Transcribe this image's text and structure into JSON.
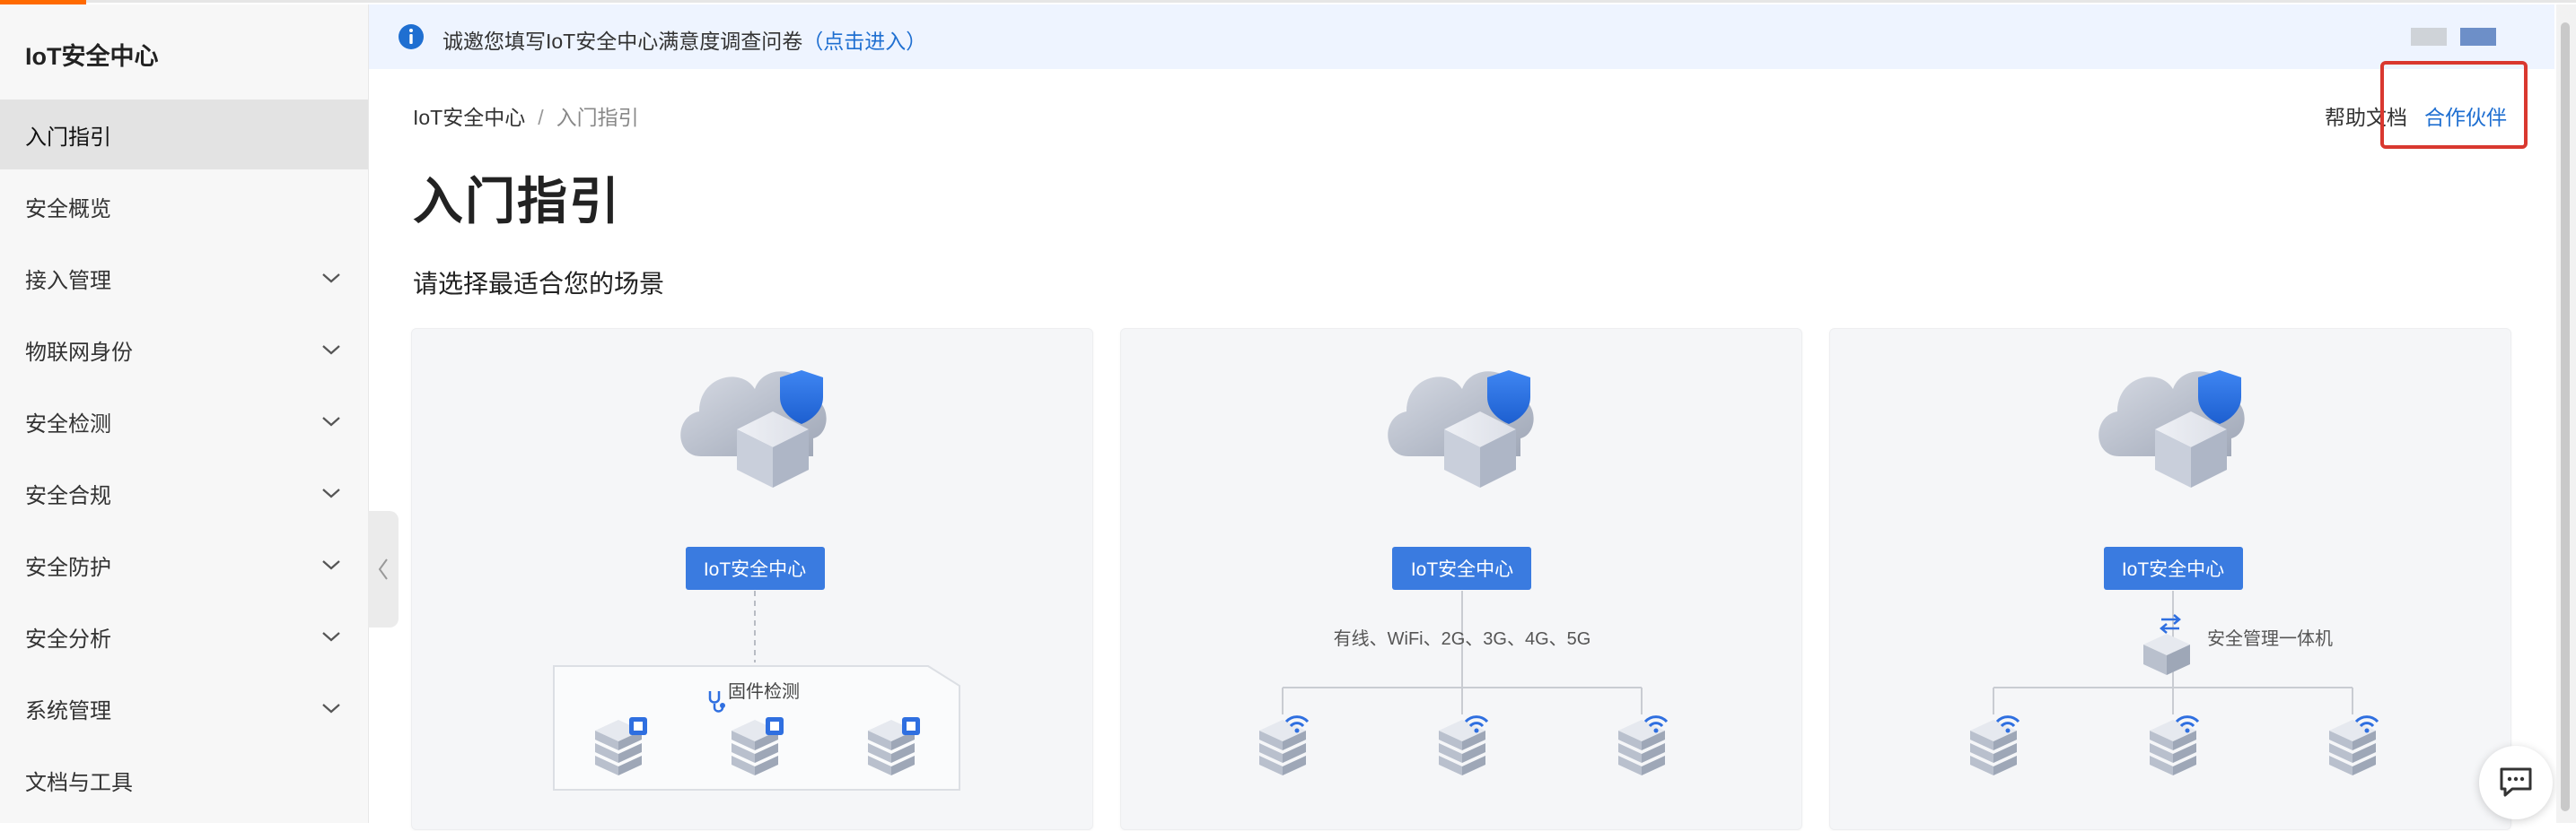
{
  "app": {
    "brand": "IoT安全中心"
  },
  "sidebar": {
    "items": [
      {
        "label": "入门指引",
        "active": true,
        "expandable": false
      },
      {
        "label": "安全概览",
        "active": false,
        "expandable": false
      },
      {
        "label": "接入管理",
        "active": false,
        "expandable": true
      },
      {
        "label": "物联网身份",
        "active": false,
        "expandable": true
      },
      {
        "label": "安全检测",
        "active": false,
        "expandable": true
      },
      {
        "label": "安全合规",
        "active": false,
        "expandable": true
      },
      {
        "label": "安全防护",
        "active": false,
        "expandable": true
      },
      {
        "label": "安全分析",
        "active": false,
        "expandable": true
      },
      {
        "label": "系统管理",
        "active": false,
        "expandable": true
      },
      {
        "label": "文档与工具",
        "active": false,
        "expandable": false
      }
    ]
  },
  "notice": {
    "text": "诚邀您填写IoT安全中心满意度调查问卷",
    "link": "（点击进入）",
    "icon": "info-icon"
  },
  "breadcrumb": {
    "root": "IoT安全中心",
    "separator": "/",
    "current": "入门指引"
  },
  "header_links": {
    "help": "帮助文档",
    "partner": "合作伙伴"
  },
  "page": {
    "title": "入门指引",
    "section_title": "请选择最适合您的场景"
  },
  "cards": [
    {
      "badge": "IoT安全中心",
      "caption": "固件检测",
      "caption_icon": "stethoscope-icon"
    },
    {
      "badge": "IoT安全中心",
      "caption": "有线、WiFi、2G、3G、4G、5G"
    },
    {
      "badge": "IoT安全中心",
      "caption": "安全管理一体机",
      "caption_icon": "router-icon"
    }
  ],
  "colors": {
    "accent": "#ff6a00",
    "link": "#1f6fd1",
    "badge": "#3a7be0",
    "highlight": "#d9382f"
  }
}
